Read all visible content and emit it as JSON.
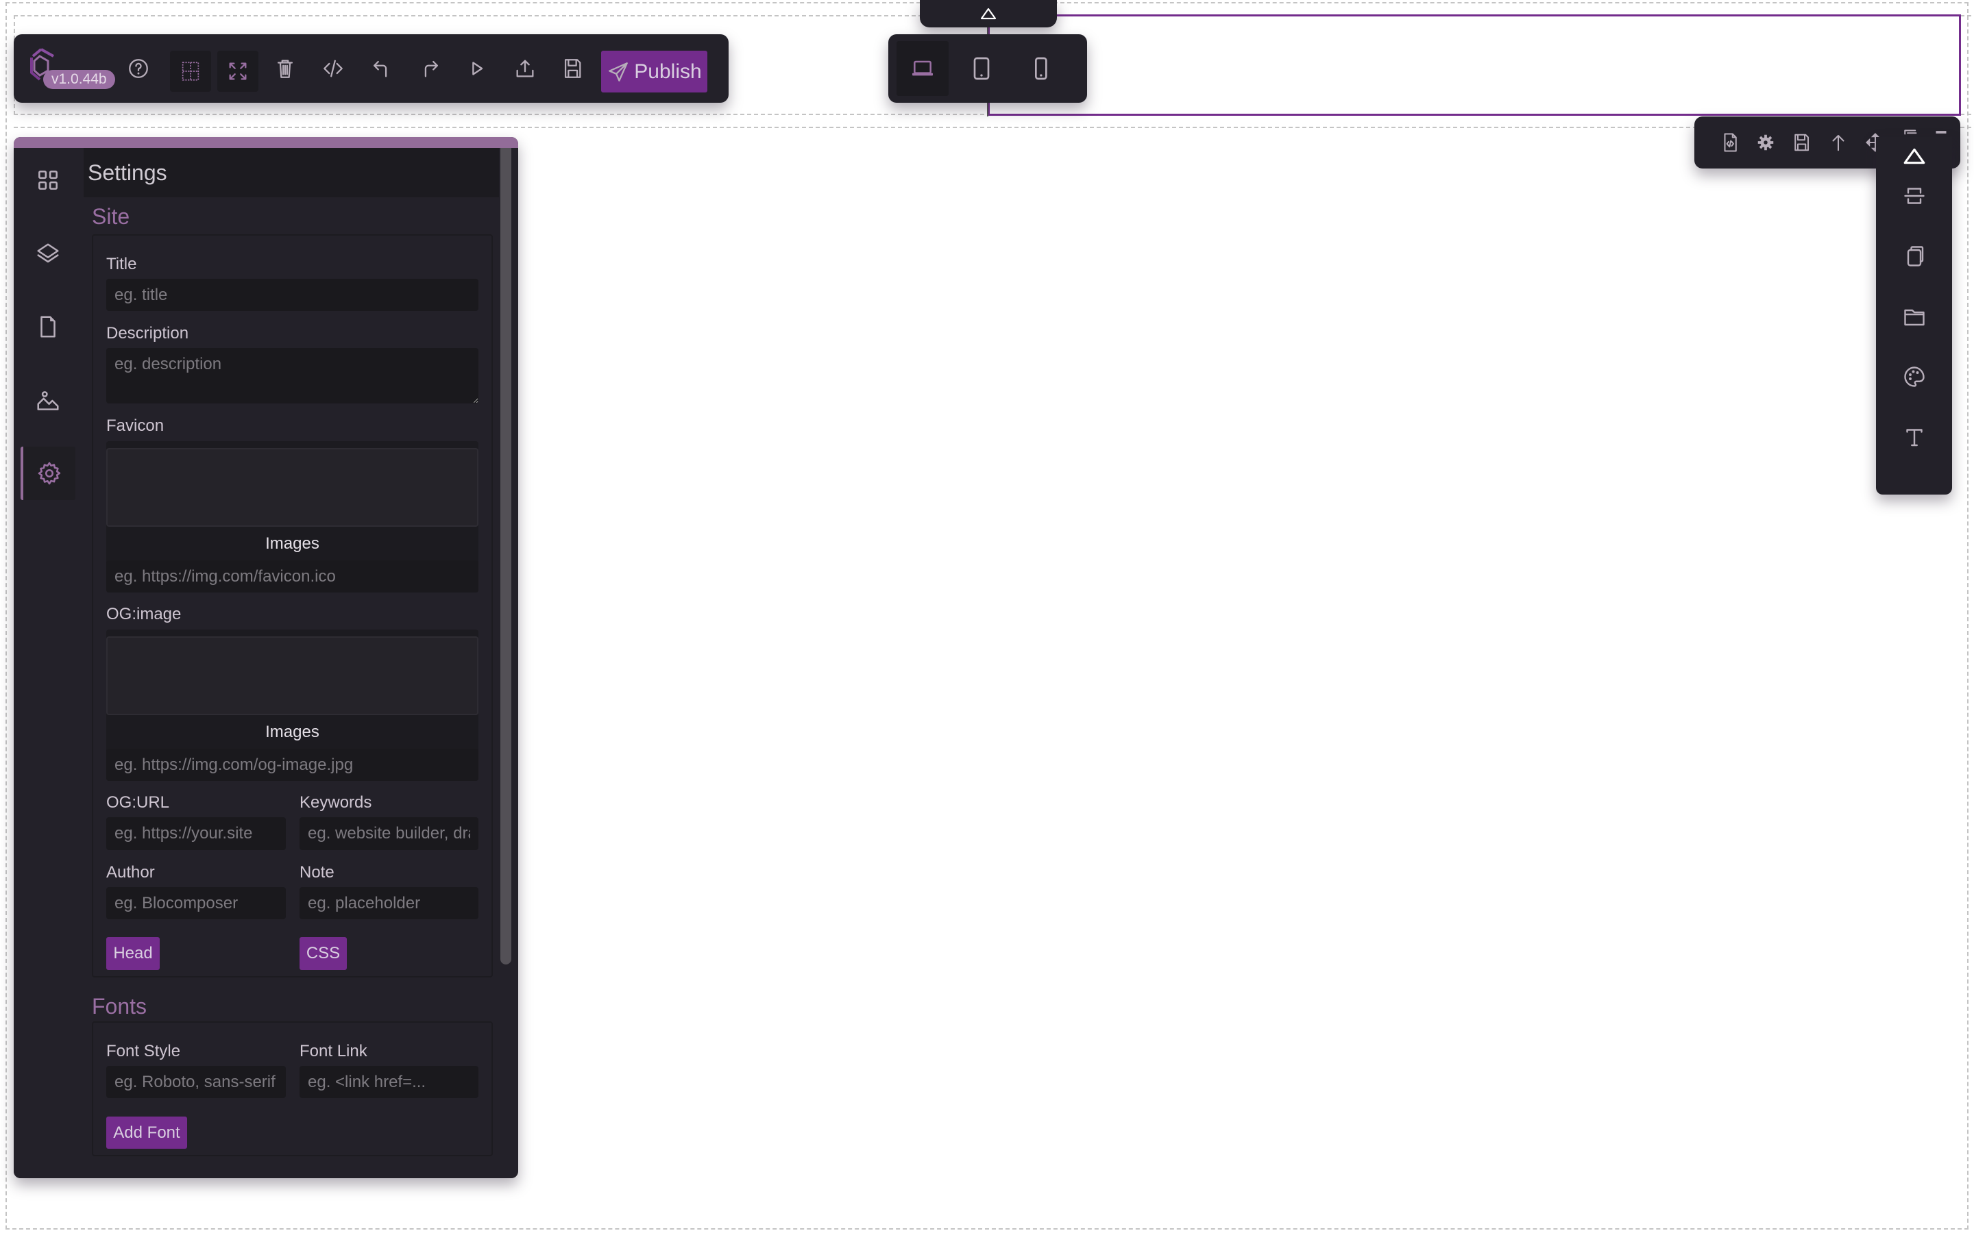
{
  "toolbar": {
    "version": "v1.0.44b",
    "publish_label": "Publish",
    "buttons": [
      "help",
      "grid-toggle",
      "fullscreen",
      "delete",
      "code",
      "undo",
      "redo",
      "preview",
      "export",
      "save"
    ]
  },
  "device_toolbar": {
    "collapse_icon": "chevron-up-icon",
    "devices": [
      "desktop",
      "tablet",
      "mobile"
    ],
    "active": "desktop"
  },
  "block_toolbar": {
    "buttons": [
      "code-file",
      "settings",
      "save",
      "move-up",
      "move",
      "copy",
      "delete"
    ]
  },
  "right_panel": {
    "buttons": [
      "collapse",
      "section",
      "pages",
      "folder",
      "palette",
      "typography"
    ]
  },
  "sidebar": {
    "items": [
      "blocks",
      "layers",
      "pages",
      "media",
      "settings"
    ],
    "active": "settings"
  },
  "settings": {
    "title": "Settings",
    "site": {
      "heading": "Site",
      "title_label": "Title",
      "title_placeholder": "eg. title",
      "description_label": "Description",
      "description_placeholder": "eg. description",
      "favicon_label": "Favicon",
      "favicon_images_label": "Images",
      "favicon_placeholder": "eg. https://img.com/favicon.ico",
      "ogimage_label": "OG:image",
      "ogimage_images_label": "Images",
      "ogimage_placeholder": "eg. https://img.com/og-image.jpg",
      "ogurl_label": "OG:URL",
      "ogurl_placeholder": "eg. https://your.site",
      "keywords_label": "Keywords",
      "keywords_placeholder": "eg. website builder, drag and drop",
      "author_label": "Author",
      "author_placeholder": "eg. Blocomposer",
      "note_label": "Note",
      "note_placeholder": "eg. placeholder",
      "head_button": "Head",
      "css_button": "CSS"
    },
    "fonts": {
      "heading": "Fonts",
      "style_label": "Font Style",
      "style_placeholder": "eg. Roboto, sans-serif",
      "link_label": "Font Link",
      "link_placeholder": "eg. <link href=...",
      "add_button": "Add Font"
    }
  },
  "colors": {
    "accent": "#732c8c",
    "accent_light": "#9a6fa3",
    "panel_bg": "#232129",
    "input_bg": "#1a191d"
  }
}
